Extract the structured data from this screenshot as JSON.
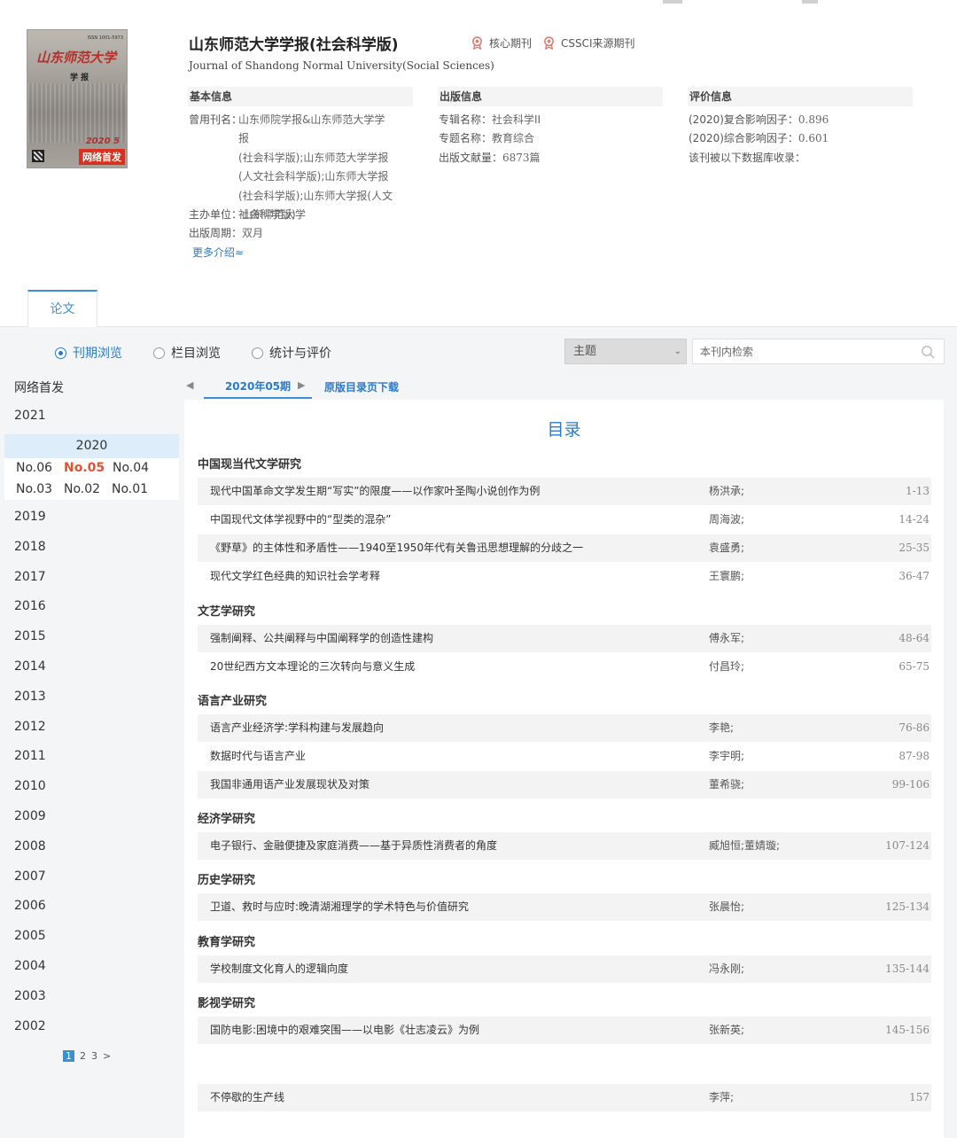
{
  "journal": {
    "title": "山东师范大学学报(社会科学版)",
    "english_title": "Journal of Shandong Normal University(Social Sciences)",
    "badges": [
      "核心期刊",
      "CSSCI来源期刊"
    ],
    "cover": {
      "title": "山东师范大学",
      "subtitle": "学 报",
      "issn": "ISSN 1001-5973",
      "year": "2020 5",
      "tag": "网络首发"
    }
  },
  "basic_info": {
    "heading": "基本信息",
    "former_names_label": "曾用刊名：",
    "former_names_lines": [
      "山东师院学报&山东师范大学学报",
      "(社会科学版);山东师范大学学报",
      "(人文社会科学版);山东师大学报",
      "(社会科学版);山东师大学报(人文",
      "社会科学版)"
    ],
    "sponsor_label": "主办单位：",
    "sponsor": "山东师范大学",
    "period_label": "出版周期：",
    "period": "双月",
    "more": "更多介绍≈"
  },
  "publish_info": {
    "heading": "出版信息",
    "series_label": "专辑名称：",
    "series": "社会科学II",
    "topic_label": "专题名称：",
    "topic": "教育综合",
    "count_label": "出版文献量：",
    "count": "6873篇"
  },
  "eval_info": {
    "heading": "评价信息",
    "composite_label": "(2020)复合影响因子：",
    "composite": "0.896",
    "overall_label": "(2020)综合影响因子：",
    "overall": "0.601",
    "db_text": "该刊被以下数据库收录："
  },
  "tabs": [
    "论文"
  ],
  "view_modes": [
    "刊期浏览",
    "栏目浏览",
    "统计与评价"
  ],
  "search": {
    "field": "主题",
    "placeholder": "本刊内检索"
  },
  "sidebar": {
    "first": "网络首发",
    "years_before": [
      "2021"
    ],
    "open_year": "2020",
    "issues": [
      "No.06",
      "No.05",
      "No.04",
      "No.03",
      "No.02",
      "No.01"
    ],
    "current_issue": "No.05",
    "years_after": [
      "2019",
      "2018",
      "2017",
      "2016",
      "2015",
      "2014",
      "2013",
      "2012",
      "2011",
      "2010",
      "2009",
      "2008",
      "2007",
      "2006",
      "2005",
      "2004",
      "2003",
      "2002"
    ],
    "pages": [
      "1",
      "2",
      "3",
      ">"
    ]
  },
  "issue_nav": {
    "current": "2020年05期",
    "download": "原版目录页下载"
  },
  "toc": {
    "title": "目录",
    "sections": [
      {
        "name": "中国现当代文学研究",
        "articles": [
          {
            "title": "现代中国革命文学发生期“写实”的限度——以作家叶圣陶小说创作为例",
            "author": "杨洪承;",
            "pages": "1-13"
          },
          {
            "title": "中国现代文体学视野中的“型类的混杂”",
            "author": "周海波;",
            "pages": "14-24"
          },
          {
            "title": "《野草》的主体性和矛盾性——1940至1950年代有关鲁迅思想理解的分歧之一",
            "author": "袁盛勇;",
            "pages": "25-35"
          },
          {
            "title": "现代文学红色经典的知识社会学考释",
            "author": "王寰鹏;",
            "pages": "36-47"
          }
        ]
      },
      {
        "name": "文艺学研究",
        "articles": [
          {
            "title": "强制阐释、公共阐释与中国阐释学的创造性建构",
            "author": "傅永军;",
            "pages": "48-64"
          },
          {
            "title": "20世纪西方文本理论的三次转向与意义生成",
            "author": "付昌玲;",
            "pages": "65-75"
          }
        ]
      },
      {
        "name": "语言产业研究",
        "articles": [
          {
            "title": "语言产业经济学:学科构建与发展趋向",
            "author": "李艳;",
            "pages": "76-86"
          },
          {
            "title": "数据时代与语言产业",
            "author": "李宇明;",
            "pages": "87-98"
          },
          {
            "title": "我国非通用语产业发展现状及对策",
            "author": "董希骁;",
            "pages": "99-106"
          }
        ]
      },
      {
        "name": "经济学研究",
        "articles": [
          {
            "title": "电子银行、金融便捷及家庭消费——基于异质性消费者的角度",
            "author": "臧旭恒;董婧璇;",
            "pages": "107-124"
          }
        ]
      },
      {
        "name": "历史学研究",
        "articles": [
          {
            "title": "卫道、救时与应时:晚清湖湘理学的学术特色与价值研究",
            "author": "张晨怡;",
            "pages": "125-134"
          }
        ]
      },
      {
        "name": "教育学研究",
        "articles": [
          {
            "title": "学校制度文化育人的逻辑向度",
            "author": "冯永刚;",
            "pages": "135-144"
          }
        ]
      },
      {
        "name": "影视学研究",
        "articles": [
          {
            "title": "国防电影:困境中的艰难突围——以电影《壮志凌云》为例",
            "author": "张新英;",
            "pages": "145-156"
          }
        ]
      },
      {
        "name": "",
        "articles": [
          {
            "title": "不停歇的生产线",
            "author": "李萍;",
            "pages": "157"
          }
        ]
      }
    ]
  },
  "colors": {
    "accent": "#2a7bd0",
    "current_issue": "#e2522f",
    "year_highlight": "#ddeefa"
  }
}
